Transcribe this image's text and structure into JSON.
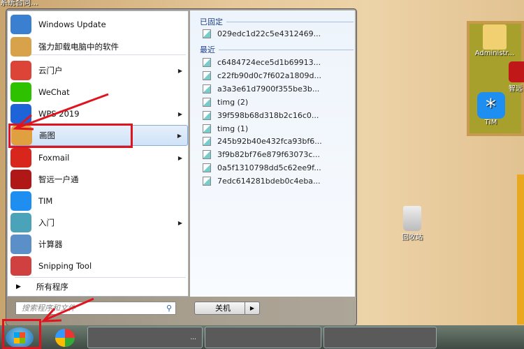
{
  "desktop": {
    "top_text": "系统合同...",
    "icons": [
      {
        "label": "Administr..."
      },
      {
        "label": "智远"
      },
      {
        "label": "TIM"
      },
      {
        "label": "回收站"
      }
    ]
  },
  "start_menu": {
    "left_items": [
      {
        "label": "Windows Update",
        "icon": "windows-update-icon",
        "color": "#3a7fd0"
      },
      {
        "label": "强力卸载电脑中的软件",
        "icon": "uninstall-box-icon",
        "color": "#d7a24a"
      },
      {
        "label": "云门户",
        "icon": "chrome-icon",
        "color": "#db4437",
        "submenu": true
      },
      {
        "label": "WeChat",
        "icon": "wechat-icon",
        "color": "#2dc100"
      },
      {
        "label": "WPS 2019",
        "icon": "wps-icon",
        "color": "#1d64d8",
        "submenu": true
      },
      {
        "label": "画图",
        "icon": "paint-palette-icon",
        "color": "#e0a040",
        "submenu": true,
        "highlighted": true
      },
      {
        "label": "Foxmail",
        "icon": "foxmail-icon",
        "color": "#d9261c",
        "submenu": true
      },
      {
        "label": "智远一户通",
        "icon": "zhiyuan-icon",
        "color": "#b01818"
      },
      {
        "label": "TIM",
        "icon": "tim-icon",
        "color": "#1e8ef0"
      },
      {
        "label": "入门",
        "icon": "getting-started-icon",
        "color": "#4aa3b8",
        "submenu": true
      },
      {
        "label": "计算器",
        "icon": "calculator-icon",
        "color": "#5b8fc8"
      },
      {
        "label": "Snipping Tool",
        "icon": "scissors-icon",
        "color": "#d04040"
      }
    ],
    "all_programs": "所有程序",
    "pinned_header": "已固定",
    "pinned": [
      "029edc1d22c5e4312469..."
    ],
    "recent_header": "最近",
    "recent": [
      "c6484724ece5d1b69913...",
      "c22fb90d0c7f602a1809d...",
      "a3a3e61d7900f355be3b...",
      "timg (2)",
      "39f598b68d318b2c16c0...",
      "timg (1)",
      "245b92b40e432fca93bf6...",
      "3f9b82bf76e879f63073c...",
      "0a5f1310798dd5c62ee9f...",
      "7edc614281bdeb0c4eba..."
    ],
    "search_placeholder": "搜索程序和文件",
    "shutdown": "关机"
  },
  "taskbar": {
    "button_suffix": "..."
  },
  "annotation_color": "#e0141e"
}
